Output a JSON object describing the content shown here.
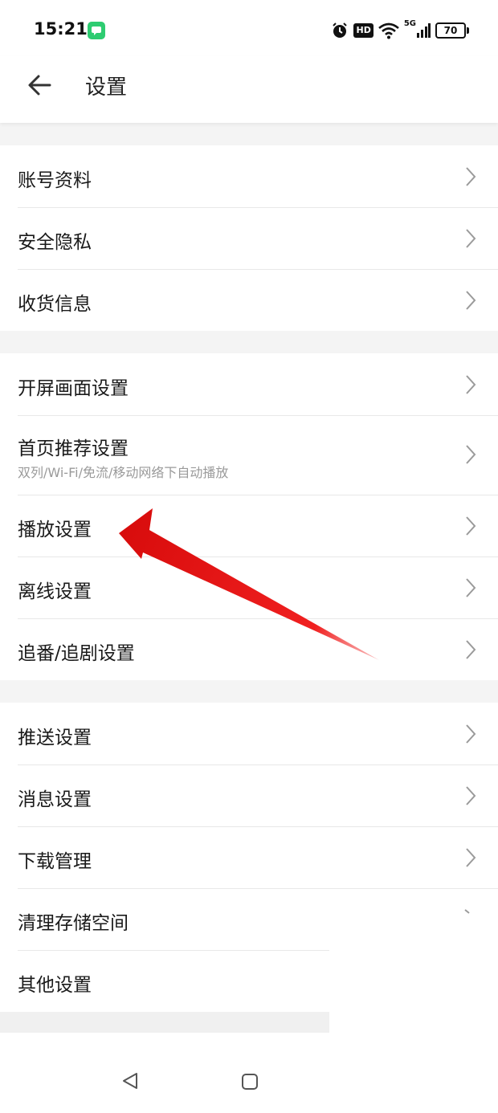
{
  "status": {
    "time": "15:21",
    "hd": "HD",
    "network": "5G",
    "battery": "70",
    "accent_app_color": "#2ecc71"
  },
  "header": {
    "back_icon": "arrow-left-icon",
    "title": "设置"
  },
  "groups": [
    {
      "items": [
        {
          "label": "账号资料"
        },
        {
          "label": "安全隐私"
        },
        {
          "label": "收货信息"
        }
      ]
    },
    {
      "items": [
        {
          "label": "开屏画面设置"
        },
        {
          "label": "首页推荐设置",
          "sub": "双列/Wi-Fi/免流/移动网络下自动播放"
        },
        {
          "label": "播放设置"
        },
        {
          "label": "离线设置"
        },
        {
          "label": "追番/追剧设置"
        }
      ]
    },
    {
      "items": [
        {
          "label": "推送设置"
        },
        {
          "label": "消息设置"
        },
        {
          "label": "下载管理"
        },
        {
          "label": "清理存储空间"
        },
        {
          "label": "其他设置"
        }
      ]
    }
  ],
  "annotation": {
    "arrow_color": "#e01010",
    "points_to": "播放设置"
  },
  "nav": {
    "back_icon": "triangle-back-icon",
    "home_icon": "square-home-icon"
  }
}
